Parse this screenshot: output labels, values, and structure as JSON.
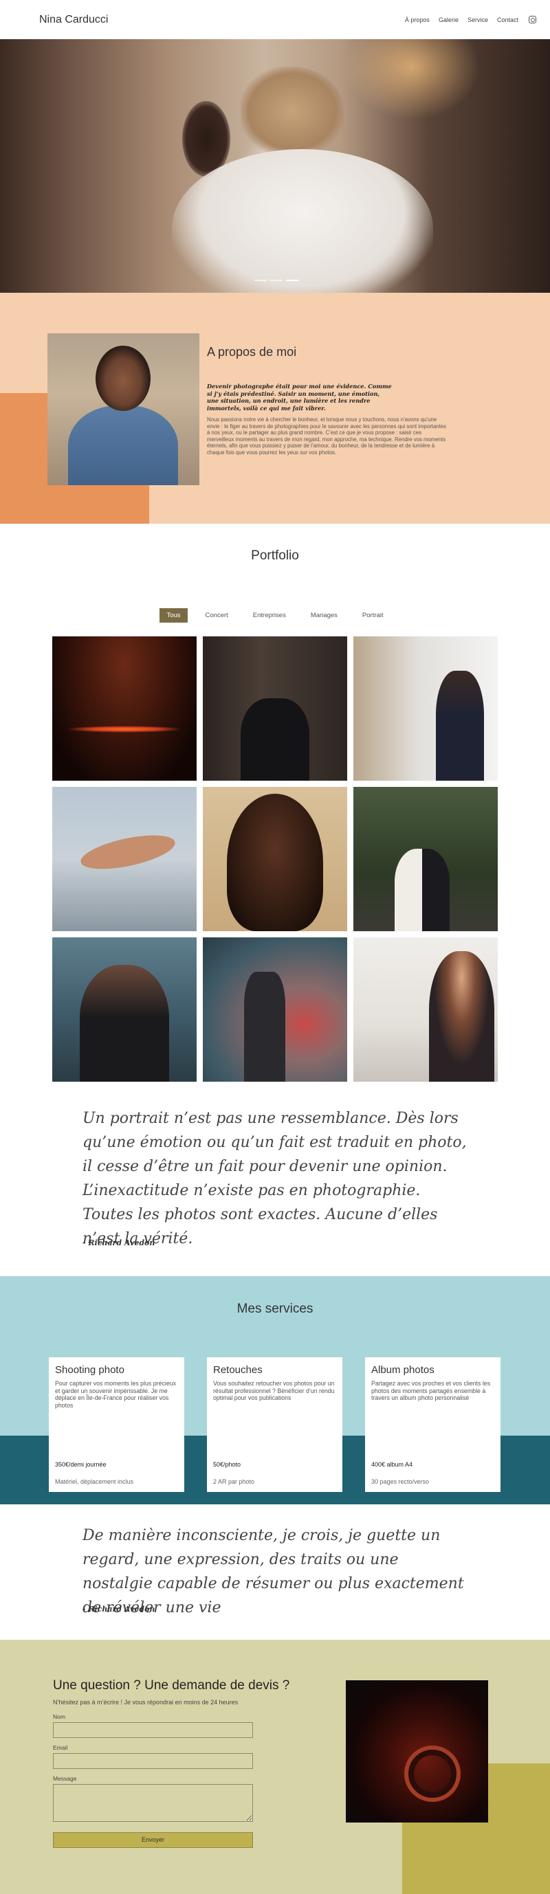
{
  "nav": {
    "brand": "Nina Carducci",
    "links": [
      "À propos",
      "Galerie",
      "Service",
      "Contact"
    ],
    "icon": "instagram-icon"
  },
  "hero": {
    "carousel_slides": 3,
    "active_slide": 3
  },
  "about": {
    "title": "A propos de moi",
    "lead": "Devenir photographe était pour moi une évidence. Comme si j’y étais prédestiné. Saisir un moment, une émotion, une situation, un endroit, une lumière et les rendre immortels, voilà ce qui me fait vibrer.",
    "body": "Nous passions notre vie à chercher le bonheur, et lorsque nous y touchons, nous n’avons qu’une envie : le figer au travers de photographies pour le savourer avec les personnes qui sont importantes à nos yeux, ou le partager au plus grand nombre. C’est ce que je vous propose : saisir ces merveilleux moments au travers de mon regard, mon approche, ma technique. Rendre vos moments éternels, afin que vous puissiez y puiser de l’amour, du bonheur, de la tendresse et de lumière à chaque fois que vous pourrez les yeux sur vos photos."
  },
  "portfolio": {
    "title": "Portfolio",
    "filters": [
      "Tous",
      "Concert",
      "Entreprises",
      "Mariages",
      "Portrait"
    ],
    "active_filter": "Tous"
  },
  "quote1": {
    "text": "Un portrait n’est pas une ressemblance. Dès lors qu’une émotion ou qu’un fait est traduit en photo, il cesse d’être un fait pour devenir une opinion. L’inexactitude n’existe pas en photographie. Toutes les photos sont exactes. Aucune d’elles n’est la vérité.",
    "author": "- Richard Avedon"
  },
  "services": {
    "title": "Mes services",
    "cards": [
      {
        "title": "Shooting photo",
        "desc": "Pour capturer vos moments les plus précieux et garder un souvenir impérissable. Je me déplace en Île-de-France pour réaliser vos photos",
        "price": "350€/demi journée",
        "note": "Matériel, déplacement inclus"
      },
      {
        "title": "Retouches",
        "desc": "Vous souhaitez retoucher vos photos pour un résultat professionnel ? Bénéficier d’un rendu optimal pour vos publications",
        "price": "50€/photo",
        "note": "2 AR par photo"
      },
      {
        "title": "Album photos",
        "desc": "Partagez avec vos proches et vos clients les photos des moments partagés ensemble à travers un album photo personnalisé",
        "price": "400€ album A4",
        "note": "30 pages recto/verso"
      }
    ]
  },
  "quote2": {
    "text": "De manière inconsciente, je crois, je guette un regard, une expression, des traits ou une nostalgie capable de résumer ou plus exactement de révéler une vie",
    "author": "- Richard Avedon"
  },
  "contact": {
    "title": "Une question ? Une demande de devis ?",
    "subtitle": "N’hésitez pas à m’écrire ! Je vous répondrai en moins de 24 heures",
    "name_label": "Nom",
    "email_label": "Email",
    "message_label": "Message",
    "submit_label": "Envoyer"
  }
}
